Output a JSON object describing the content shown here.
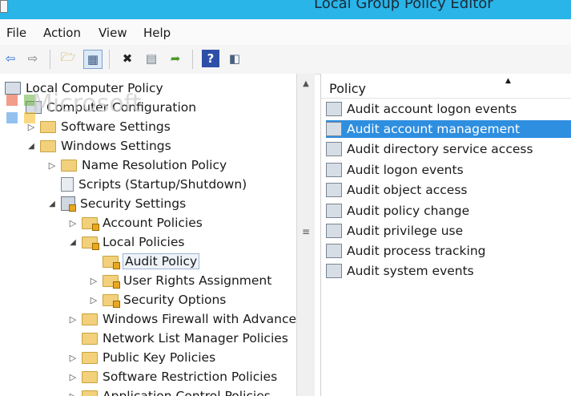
{
  "window": {
    "title": "Local Group Policy Editor"
  },
  "menu": [
    "File",
    "Action",
    "View",
    "Help"
  ],
  "toolbar": {
    "buttons": [
      "back-icon",
      "forward-icon",
      "up-folder-icon",
      "show-hide-tree-icon",
      "delete-icon",
      "properties-icon",
      "export-list-icon",
      "help-icon",
      "show-action-pane-icon"
    ]
  },
  "tree": {
    "root": "Local Computer Policy",
    "computer_config": "Computer Configuration",
    "software_settings": "Software Settings",
    "windows_settings": "Windows Settings",
    "name_resolution": "Name Resolution Policy",
    "scripts": "Scripts (Startup/Shutdown)",
    "security_settings": "Security Settings",
    "account_policies": "Account Policies",
    "local_policies": "Local Policies",
    "audit_policy": "Audit Policy",
    "user_rights": "User Rights Assignment",
    "security_options": "Security Options",
    "windows_firewall": "Windows Firewall with Advanced",
    "network_list": "Network List Manager Policies",
    "public_key": "Public Key Policies",
    "software_restriction": "Software Restriction Policies",
    "application_control": "Application Control Policies"
  },
  "list": {
    "column": "Policy",
    "items": [
      "Audit account logon events",
      "Audit account management",
      "Audit directory service access",
      "Audit logon events",
      "Audit object access",
      "Audit policy change",
      "Audit privilege use",
      "Audit process tracking",
      "Audit system events"
    ],
    "selected_index": 1
  },
  "watermark": {
    "text": "Microsoft"
  },
  "colors": {
    "titlebar": "#29b5e8",
    "selection": "#2e8ee0"
  }
}
